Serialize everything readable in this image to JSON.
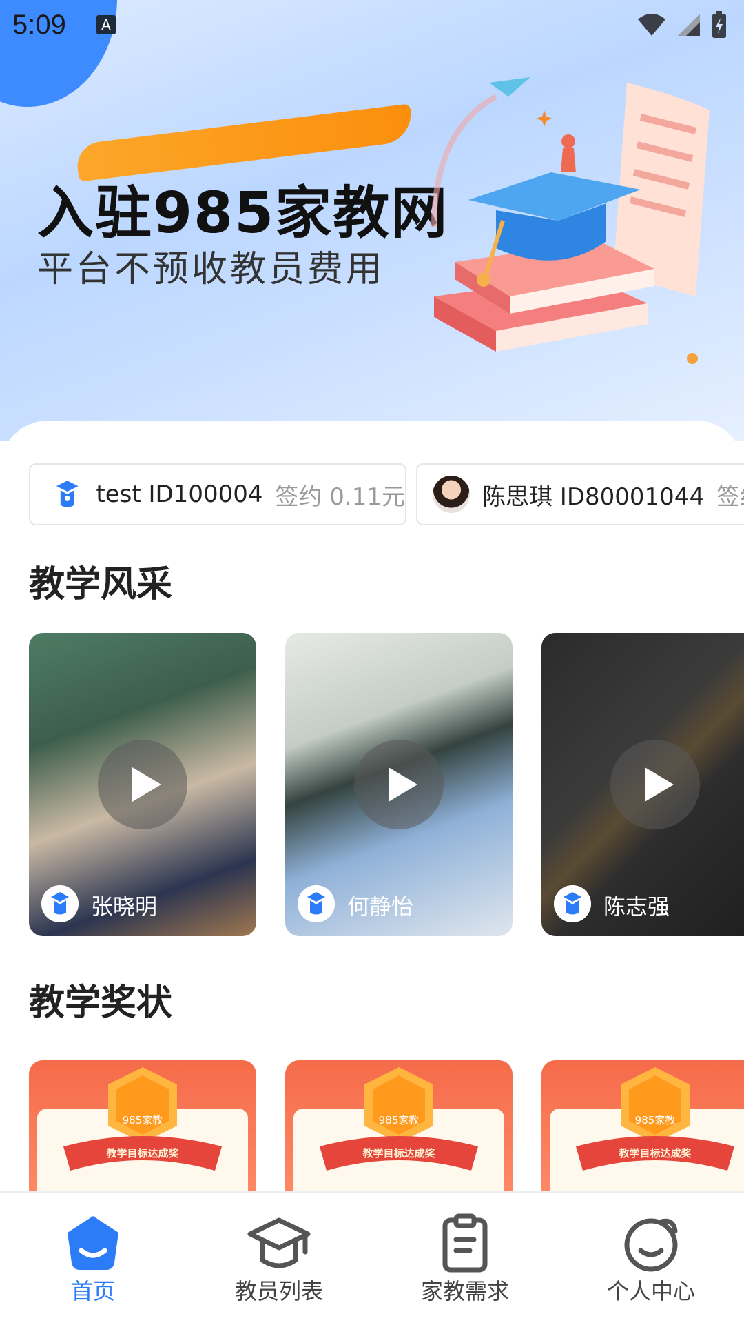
{
  "status_bar": {
    "time": "5:09",
    "notif_icon": "A"
  },
  "banner": {
    "title": "入驻985家教网",
    "subtitle": "平台不预收教员费用"
  },
  "ticker": [
    {
      "name": "test ID100004",
      "sign": "签约 0.11元"
    },
    {
      "name": "陈思琪 ID80001044",
      "sign": "签约"
    }
  ],
  "sections": {
    "teaching_style": "教学风采",
    "awards": "教学奖状"
  },
  "videos": [
    {
      "name": "张晓明"
    },
    {
      "name": "何静怡"
    },
    {
      "name": "陈志强"
    }
  ],
  "award_card": {
    "brand": "985家教",
    "ribbon": "教学目标达成奖"
  },
  "nav": [
    {
      "label": "首页",
      "icon": "home-icon",
      "active": true
    },
    {
      "label": "教员列表",
      "icon": "graduation-cap-icon",
      "active": false
    },
    {
      "label": "家教需求",
      "icon": "clipboard-icon",
      "active": false
    },
    {
      "label": "个人中心",
      "icon": "profile-icon",
      "active": false
    }
  ],
  "colors": {
    "accent": "#2b7cf6",
    "brush": "#ff9a12",
    "award": "#f56b4a"
  }
}
